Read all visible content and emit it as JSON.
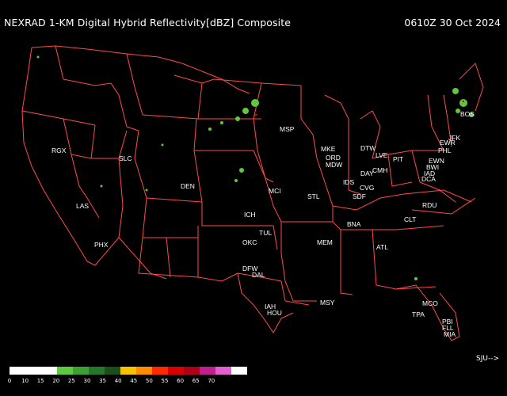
{
  "header": {
    "title": "NEXRAD 1-KM Digital Hybrid Reflectivity[dBZ] Composite",
    "timestamp": "0610Z 30 Oct 2024"
  },
  "colors": {
    "background": "#000000",
    "boundaries": "#ff4a4a",
    "text": "#ffffff"
  },
  "stations": [
    "RGX",
    "SLC",
    "LAS",
    "PHX",
    "DEN",
    "MSP",
    "MKE",
    "ORD",
    "MDW",
    "DTW",
    "LVE",
    "PIT",
    "EWR",
    "PHL",
    "JFK",
    "BOS",
    "EWN",
    "BWI",
    "IAD",
    "DCA",
    "CMH",
    "DAY",
    "IDS",
    "CVG",
    "SDF",
    "STL",
    "MCI",
    "ICH",
    "TUL",
    "OKC",
    "DFW",
    "DAL",
    "IAH",
    "HOU",
    "MSY",
    "MEM",
    "BNA",
    "ATL",
    "CLT",
    "RDU",
    "MCO",
    "TPA",
    "PBI",
    "FLL",
    "MIA"
  ],
  "legend": {
    "colors": [
      "#ffffff",
      "#ffffff",
      "#ffffff",
      "#5ec83e",
      "#3ea033",
      "#23782a",
      "#1a4f1c",
      "#f6c400",
      "#ff8c00",
      "#ff2a00",
      "#d80000",
      "#b00018",
      "#c0208a",
      "#e060d0",
      "#ffffff"
    ],
    "labels": [
      "0",
      "10",
      "15",
      "20",
      "25",
      "30",
      "35",
      "40",
      "45",
      "50",
      "55",
      "60",
      "65",
      "70"
    ]
  },
  "navigation": {
    "label": "SJU-->"
  }
}
